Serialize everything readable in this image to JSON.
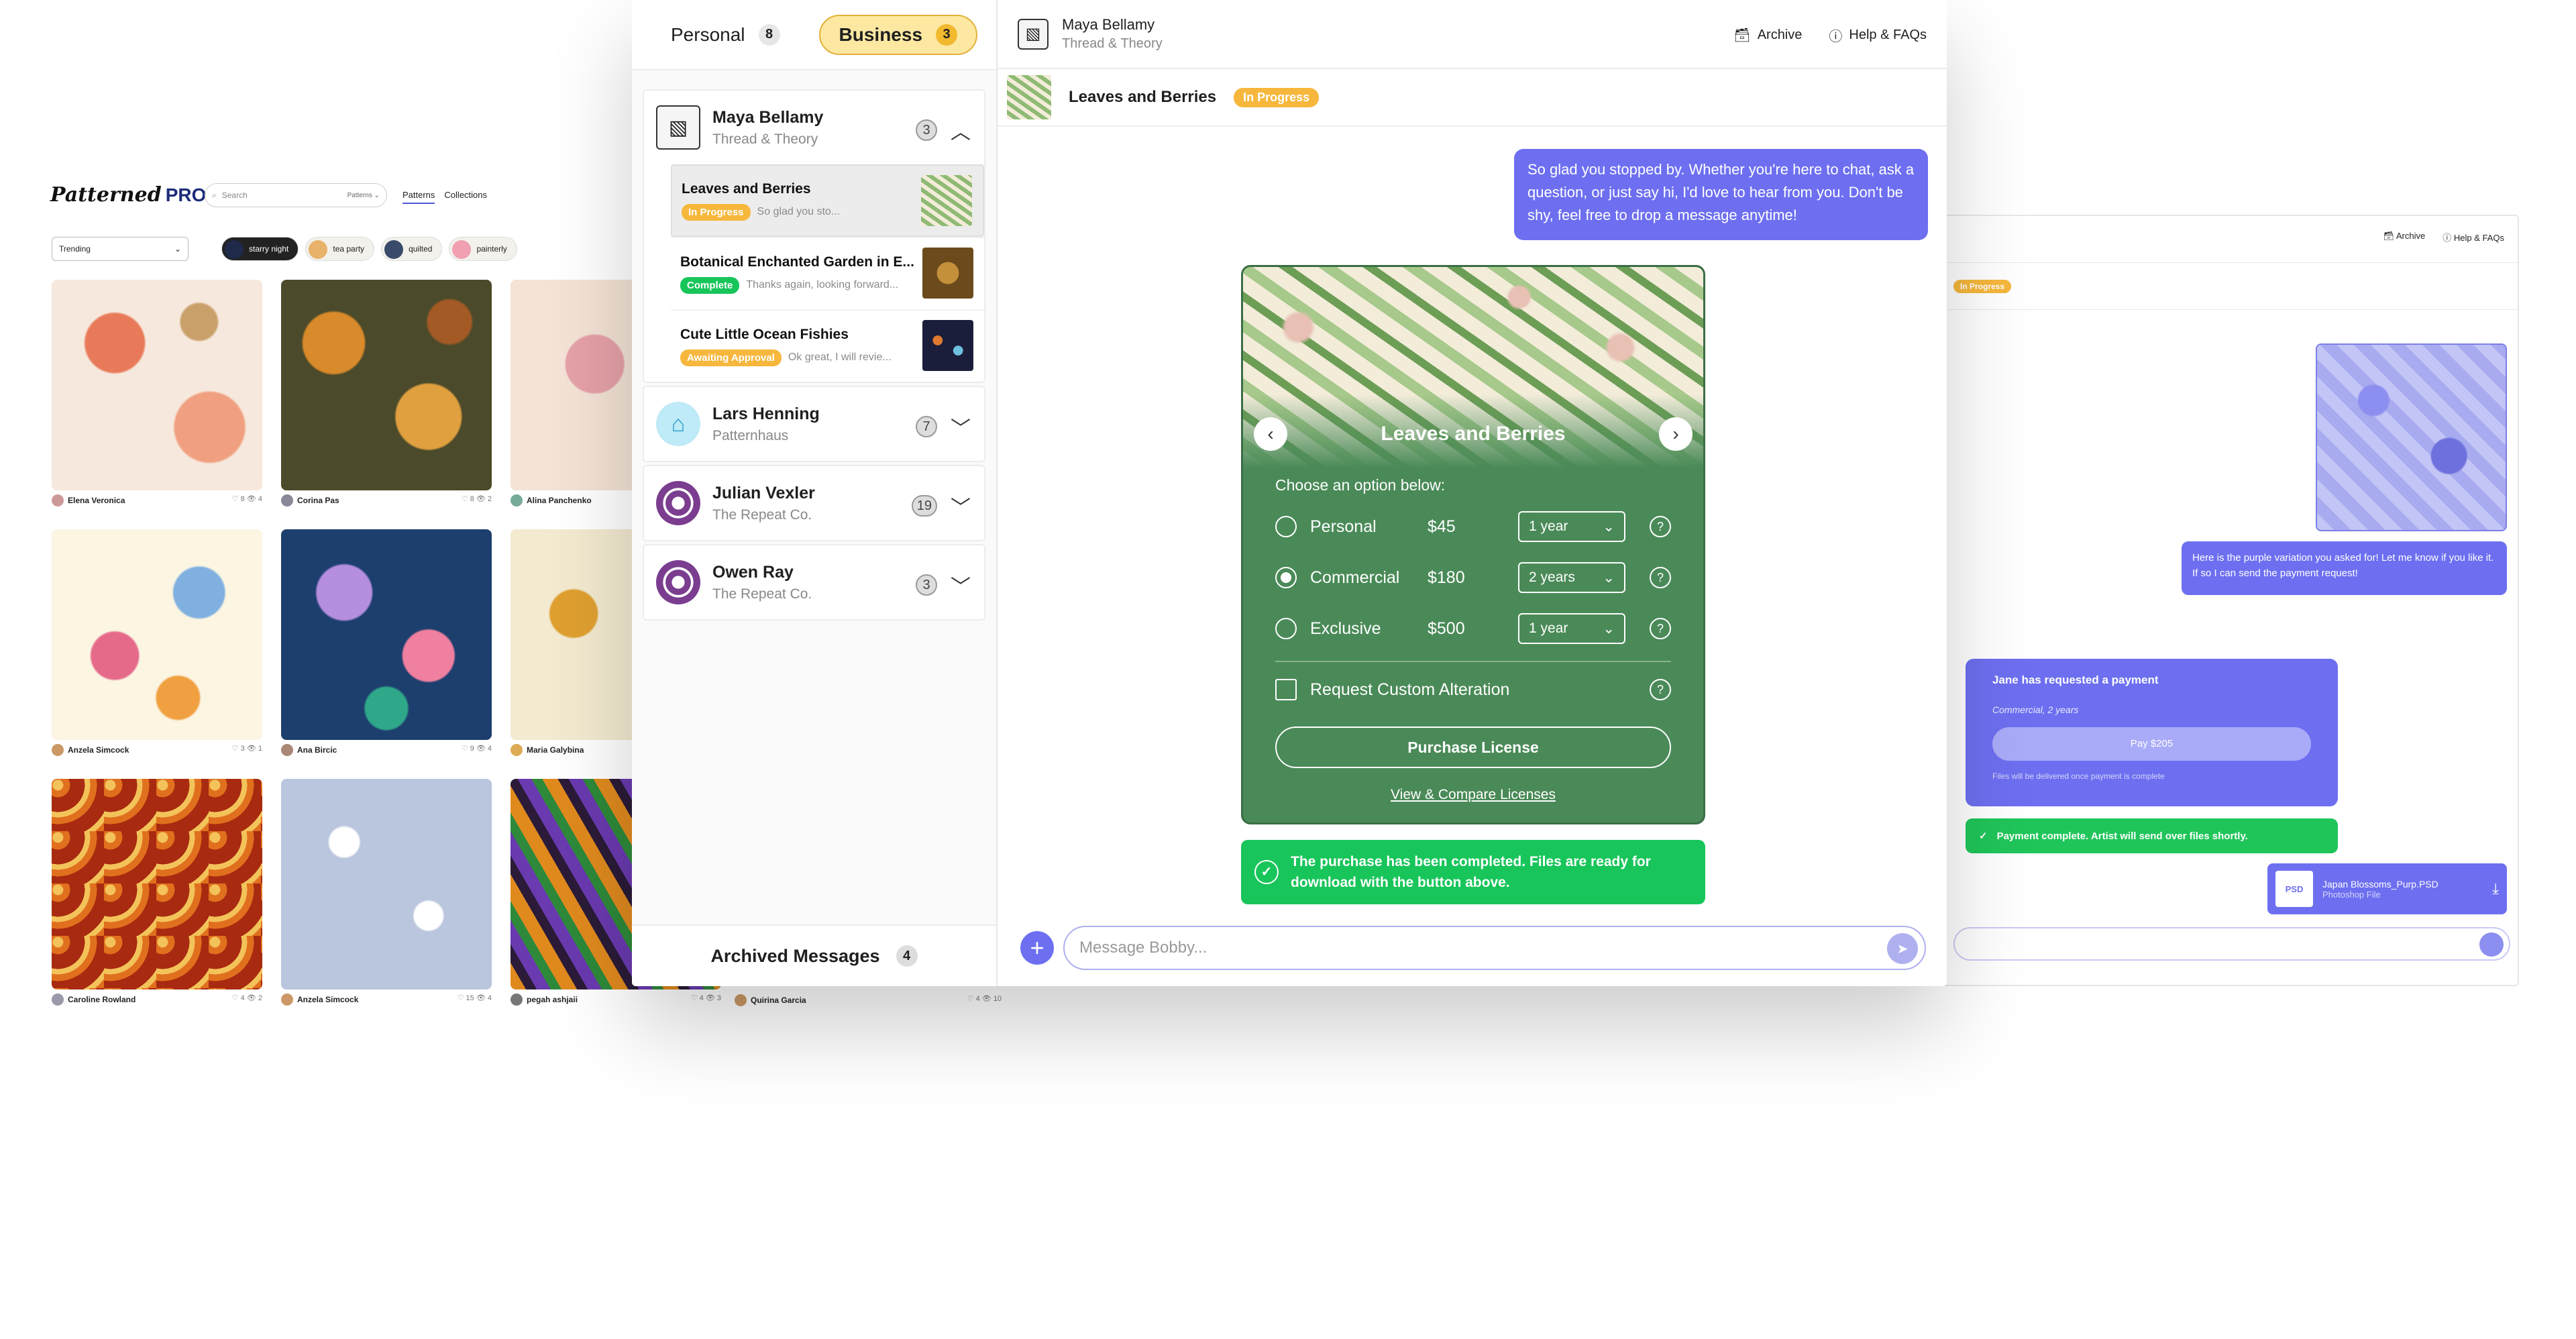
{
  "gallery": {
    "logo": "Patterned",
    "logo_pro": "PRO",
    "search_placeholder": "Search",
    "search_scope": "Patterns ⌄",
    "tabs": [
      "Patterns",
      "Collections"
    ],
    "sort": "Trending",
    "chips": [
      "starry night",
      "tea party",
      "quilted",
      "painterly"
    ],
    "tiles": [
      {
        "artist": "Elena Veronica",
        "stats": "♡ 8 👁 4"
      },
      {
        "artist": "Corina Pas",
        "stats": "♡ 8 👁 2"
      },
      {
        "artist": "Alina Panchenko",
        "stats": ""
      },
      {
        "artist": "Anzela Simcock",
        "stats": "♡ 3 👁 1"
      },
      {
        "artist": "Ana Bircic",
        "stats": "♡ 9 👁 4"
      },
      {
        "artist": "Maria Galybina",
        "stats": ""
      },
      {
        "artist": "Caroline Rowland",
        "stats": "♡ 4 👁 2"
      },
      {
        "artist": "Anzela Simcock",
        "stats": "♡ 15 👁 4"
      },
      {
        "artist": "pegah ashjaii",
        "stats": "♡ 4 👁 3"
      }
    ],
    "extra_artist": "Quirina Garcia",
    "extra_stats": "♡ 4 👁 10"
  },
  "bg_chat": {
    "archive": "Archive",
    "help": "Help & FAQs",
    "status": "In Progress",
    "bubble": "Here is the purple variation you asked for! Let me know if you like it. If so I can send the payment request!",
    "payment_title": "Jane has requested a payment",
    "payment_sub": "Commercial, 2 years",
    "pay_button": "Pay $205",
    "payment_note": "Files will be delivered once payment is complete",
    "payment_done": "Payment complete. Artist will send over files shortly.",
    "file_badge": "PSD",
    "file_name": "Japan Blossoms_Purp.PSD",
    "file_type": "Photoshop File"
  },
  "sidebar": {
    "tabs": [
      {
        "label": "Personal",
        "count": "8"
      },
      {
        "label": "Business",
        "count": "3"
      }
    ],
    "conversations": [
      {
        "name": "Maya Bellamy",
        "company": "Thread & Theory",
        "count": "3",
        "threads": [
          {
            "title": "Leaves and Berries",
            "status": "In Progress",
            "preview": "So glad you sto..."
          },
          {
            "title": "Botanical Enchanted Garden in E...",
            "status": "Complete",
            "preview": "Thanks again, looking forward..."
          },
          {
            "title": "Cute Little Ocean Fishies",
            "status": "Awaiting Approval",
            "preview": "Ok great, I will revie..."
          }
        ]
      },
      {
        "name": "Lars Henning",
        "company": "Patternhaus",
        "count": "7"
      },
      {
        "name": "Julian Vexler",
        "company": "The Repeat Co.",
        "count": "19"
      },
      {
        "name": "Owen Ray",
        "company": "The Repeat Co.",
        "count": "3"
      }
    ],
    "archived_label": "Archived Messages",
    "archived_count": "4"
  },
  "chat": {
    "contact_name": "Maya Bellamy",
    "contact_company": "Thread & Theory",
    "archive": "Archive",
    "help": "Help & FAQs",
    "thread_title": "Leaves and Berries",
    "thread_status": "In Progress",
    "message": "So glad you stopped by. Whether you're here to chat, ask a question, or just say hi, I'd love to hear from you. Don't be shy, feel free to drop a message anytime!",
    "card": {
      "title": "Leaves and Berries",
      "choose": "Choose an option below:",
      "options": [
        {
          "label": "Personal",
          "price": "$45",
          "term": "1 year",
          "selected": false
        },
        {
          "label": "Commercial",
          "price": "$180",
          "term": "2 years",
          "selected": true
        },
        {
          "label": "Exclusive",
          "price": "$500",
          "term": "1 year",
          "selected": false
        }
      ],
      "custom": "Request Custom Alteration",
      "purchase": "Purchase License",
      "compare": "View & Compare Licenses"
    },
    "purchase_done": "The purchase has been completed. Files are ready for download with the button above.",
    "composer_placeholder": "Message Bobby..."
  },
  "colors": {
    "accent": "#6d6ff0",
    "card_green": "#4a8a58",
    "success": "#18c55a",
    "warning": "#f6b73c",
    "business_tab": "#fde8a2"
  }
}
